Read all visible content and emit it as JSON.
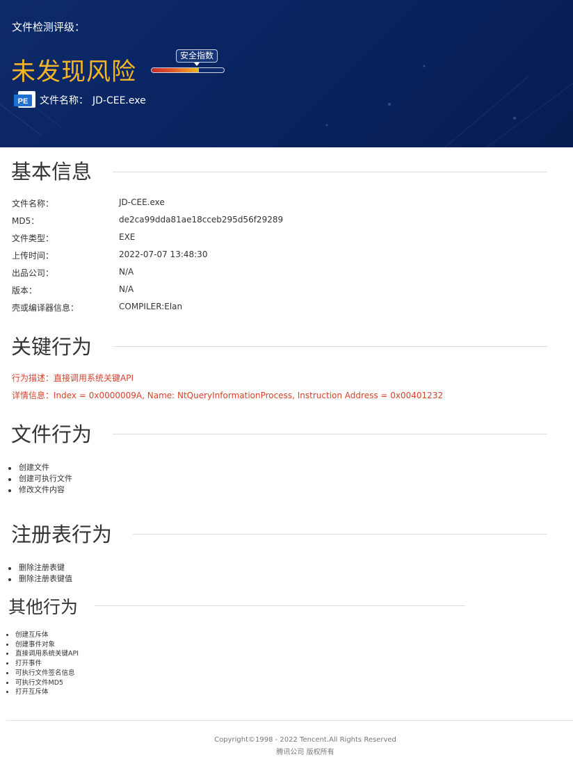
{
  "header": {
    "label": "文件检测评级：",
    "verdict": "未发现风险",
    "score_tip": "安全指数",
    "score_fraction": 0.65,
    "file_icon": "pe-file-icon",
    "file_icon_text": "PE",
    "filename_label": "文件名称：",
    "filename_value": "JD-CEE.exe"
  },
  "basic": {
    "title": "基本信息",
    "rows": [
      {
        "key": "文件名称：",
        "value": "JD-CEE.exe"
      },
      {
        "key": "MD5：",
        "value": "de2ca99dda81ae18cceb295d56f29289"
      },
      {
        "key": "文件类型：",
        "value": "EXE"
      },
      {
        "key": "上传时间：",
        "value": "2022-07-07 13:48:30"
      },
      {
        "key": "出品公司：",
        "value": "N/A"
      },
      {
        "key": "版本：",
        "value": "N/A"
      },
      {
        "key": "壳或编译器信息：",
        "value": "COMPILER:Elan"
      }
    ]
  },
  "key_behavior": {
    "title": "关键行为",
    "desc": "行为描述：直接调用系统关键API",
    "detail": "详情信息：Index = 0x0000009A, Name: NtQueryInformationProcess, Instruction Address = 0x00401232"
  },
  "file_behavior": {
    "title": "文件行为",
    "items": [
      "创建文件",
      "创建可执行文件",
      "修改文件内容"
    ]
  },
  "registry_behavior": {
    "title": "注册表行为",
    "items": [
      "删除注册表键",
      "删除注册表键值"
    ]
  },
  "other_behavior": {
    "title": "其他行为",
    "items": [
      "创建互斥体",
      "创建事件对象",
      "直接调用系统关键API",
      "打开事件",
      "可执行文件签名信息",
      "可执行文件MD5",
      "打开互斥体"
    ]
  },
  "footer": {
    "copyright": "Copyright©1998 - 2022 Tencent.All Rights Reserved",
    "company": "腾讯公司 版权所有"
  },
  "colors": {
    "header_bg": "#0a2460",
    "verdict": "#f5b526",
    "critical": "#d9402b",
    "pe_icon": "#1f6fd1"
  }
}
